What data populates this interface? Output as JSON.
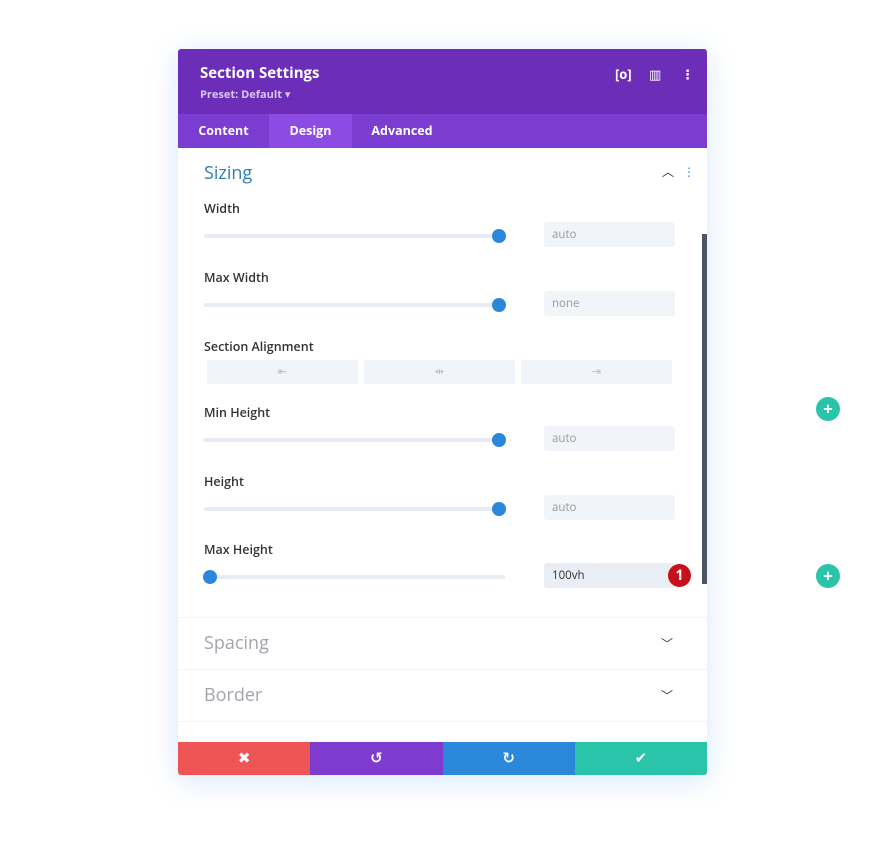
{
  "header": {
    "title": "Section Settings",
    "preset": "Preset: Default ▾",
    "icons": [
      "focus-icon",
      "split-view-icon",
      "more-icon"
    ]
  },
  "tabs": [
    {
      "label": "Content"
    },
    {
      "label": "Design",
      "active": true
    },
    {
      "label": "Advanced"
    }
  ],
  "sizing": {
    "title": "Sizing",
    "fields": [
      {
        "label": "Width",
        "value": "auto",
        "slider": 1.0
      },
      {
        "label": "Max Width",
        "value": "none",
        "slider": 1.0
      },
      {
        "label": "Min Height",
        "value": "auto",
        "slider": 1.0
      },
      {
        "label": "Height",
        "value": "auto",
        "slider": 1.0
      },
      {
        "label": "Max Height",
        "value": "100vh",
        "slider": 0.0
      }
    ],
    "alignment": {
      "label": "Section Alignment",
      "options": [
        "⇤",
        "⇹",
        "⇥"
      ]
    }
  },
  "badge": "1",
  "collapsed": [
    {
      "title": "Spacing"
    },
    {
      "title": "Border"
    }
  ],
  "footer": {
    "cancel": "✖",
    "undo": "↺",
    "redo": "↻",
    "save": "✔"
  },
  "colors": {
    "header": "#6c2eb9",
    "accent": "#2b87da",
    "cancel": "#ef5555",
    "undo": "#7e3bd0",
    "redo": "#2b87da",
    "save": "#29c4a9"
  },
  "add": "+"
}
